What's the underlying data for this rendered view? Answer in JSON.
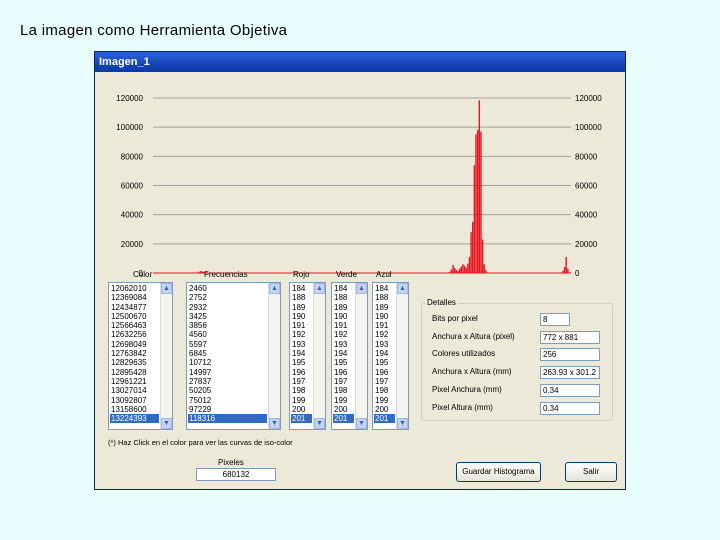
{
  "slide": {
    "title": "La imagen como Herramienta Objetiva"
  },
  "window": {
    "title": "Imagen_1"
  },
  "chart_data": {
    "type": "bar",
    "title": "",
    "xlabel": "",
    "ylabel": "",
    "ylim": [
      0,
      120000
    ],
    "yticks": [
      "120000",
      "100000",
      "80000",
      "60000",
      "40000",
      "20000",
      "0"
    ],
    "grid": true,
    "color": "#e8111d",
    "x": [
      28,
      29,
      30,
      31,
      32,
      33,
      34,
      35,
      60,
      120,
      160,
      181,
      182,
      183,
      184,
      185,
      186,
      187,
      188,
      189,
      190,
      191,
      192,
      193,
      194,
      195,
      196,
      197,
      198,
      199,
      200,
      201,
      202,
      203,
      250,
      251,
      252,
      253
    ],
    "values": [
      900,
      1300,
      1100,
      700,
      500,
      400,
      300,
      300,
      200,
      250,
      300,
      1000,
      2500,
      5500,
      3500,
      2000,
      1500,
      3000,
      4500,
      6000,
      5000,
      3500,
      6500,
      11000,
      28000,
      35000,
      74000,
      95000,
      98000,
      118316,
      97000,
      23000,
      6000,
      2000,
      1500,
      4000,
      11000,
      3000
    ]
  },
  "columns": {
    "color": "Color",
    "freq": "Frecuencias",
    "rojo": "Rojo",
    "verde": "Verde",
    "azul": "Azul"
  },
  "lists": {
    "color": [
      "12062010",
      "12369084",
      "12434877",
      "12500670",
      "12566463",
      "12632256",
      "12698049",
      "12763842",
      "12829635",
      "12895428",
      "12961221",
      "13027014",
      "13092807",
      "13158600",
      "13224393"
    ],
    "freq": [
      "2460",
      "2752",
      "2932",
      "3425",
      "3856",
      "4560",
      "5597",
      "6845",
      "10712",
      "14997",
      "27837",
      "50205",
      "75012",
      "97229",
      "118316"
    ],
    "rojo": [
      "184",
      "188",
      "189",
      "190",
      "191",
      "192",
      "193",
      "194",
      "195",
      "196",
      "197",
      "198",
      "199",
      "200",
      "201"
    ],
    "verde": [
      "184",
      "188",
      "189",
      "190",
      "191",
      "192",
      "193",
      "194",
      "195",
      "196",
      "197",
      "198",
      "199",
      "200",
      "201"
    ],
    "azul": [
      "184",
      "188",
      "189",
      "190",
      "191",
      "192",
      "193",
      "194",
      "195",
      "196",
      "197",
      "198",
      "199",
      "200",
      "201"
    ]
  },
  "details": {
    "title": "Detalles",
    "rows": [
      {
        "label": "Bits por pixel",
        "value": "8"
      },
      {
        "label": "Anchura x Altura (pixel)",
        "value": "772 x 881"
      },
      {
        "label": "Colores utilizados",
        "value": "256"
      },
      {
        "label": "Anchura x Altura (mm)",
        "value": "263.93 x 301.2"
      },
      {
        "label": "Pixel Anchura (mm)",
        "value": "0.34"
      },
      {
        "label": "Pixel Altura (mm)",
        "value": "0.34"
      }
    ]
  },
  "hint": "(*) Haz Click en el color para ver las curvas de iso-color",
  "pixels": {
    "label": "Pixeles",
    "value": "680132"
  },
  "buttons": {
    "save": "Guardar Histograma",
    "exit": "Salir"
  }
}
